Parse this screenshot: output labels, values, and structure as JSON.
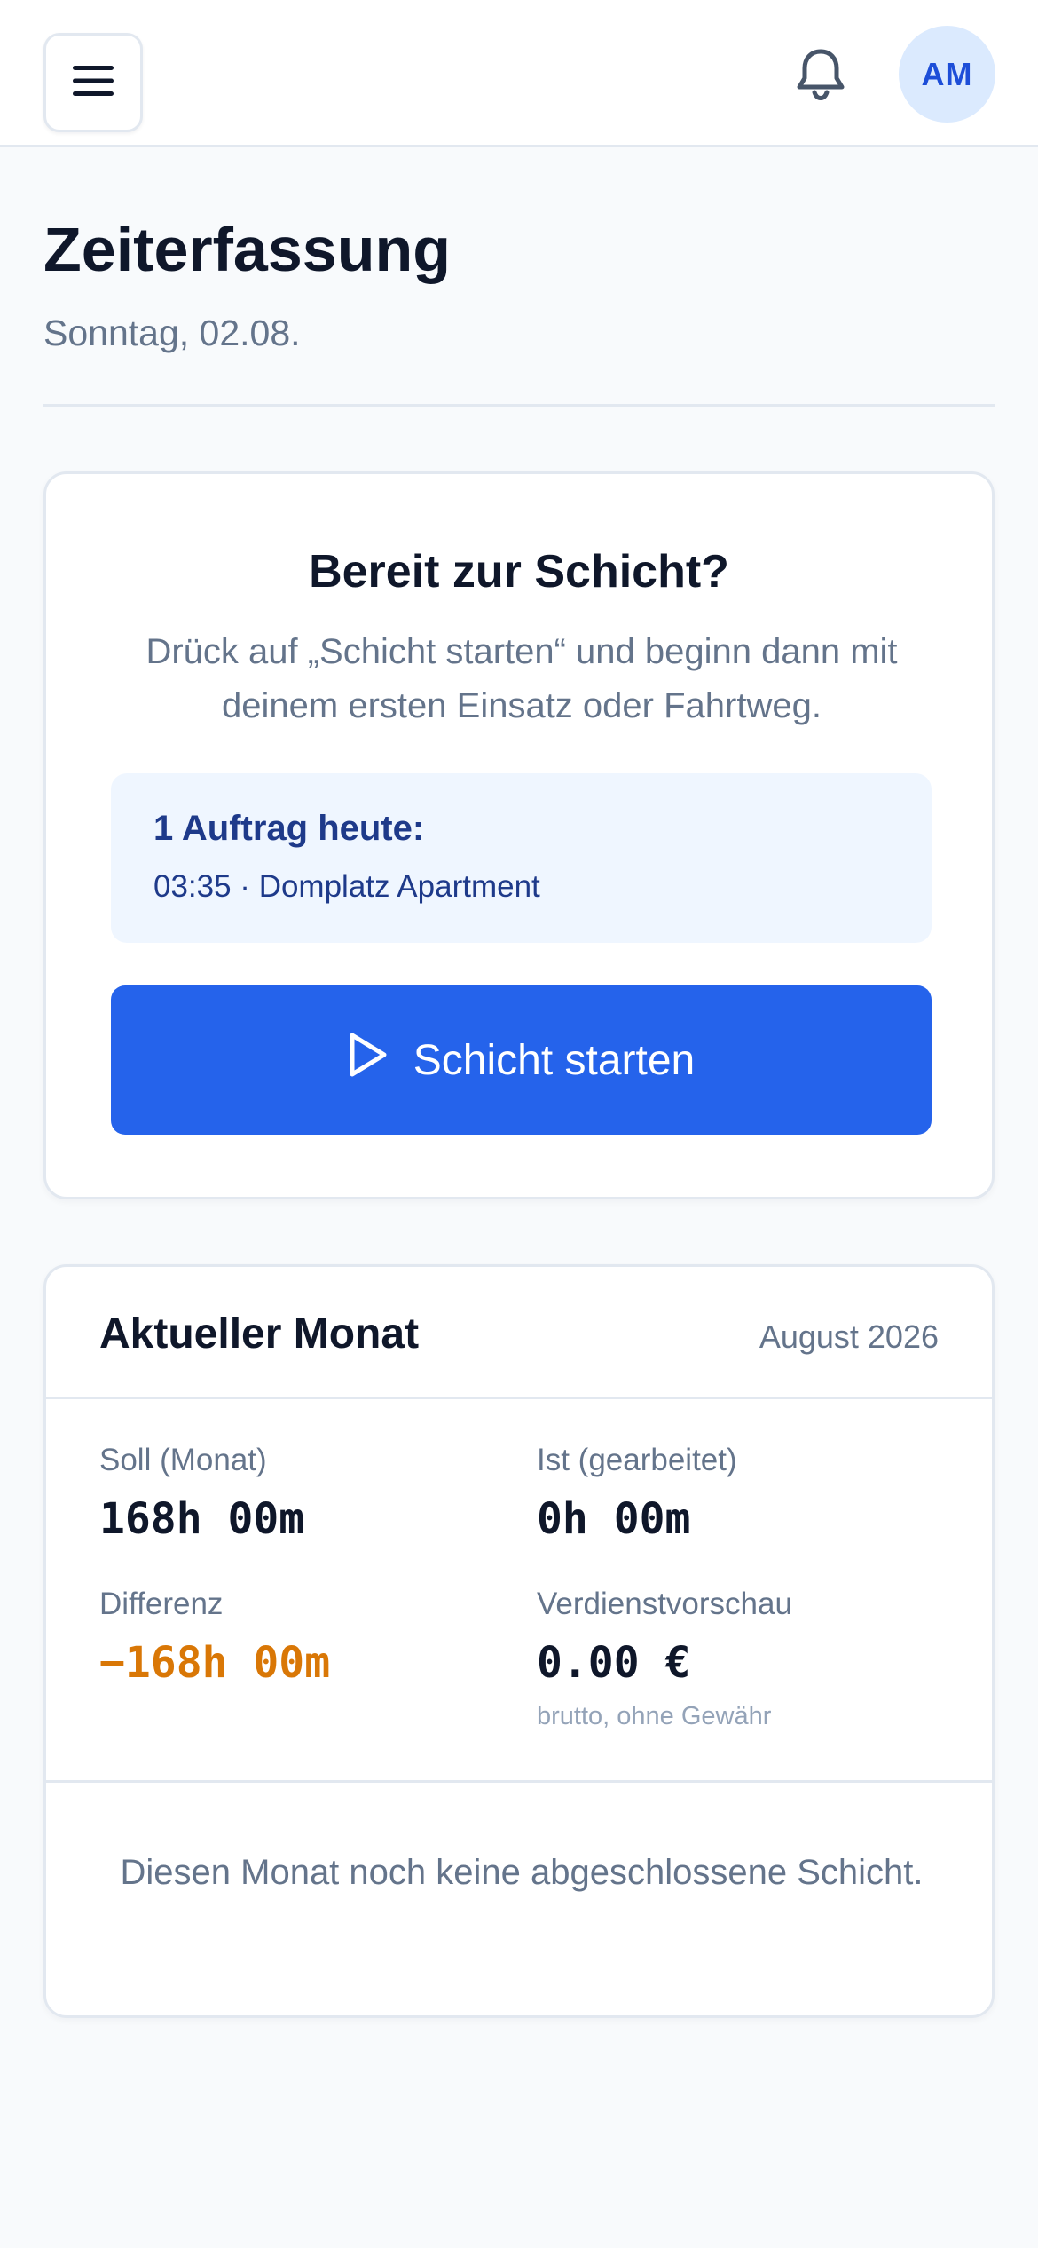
{
  "header": {
    "avatar_initials": "AM",
    "icons": {
      "menu": "menu-icon",
      "notifications": "bell-icon"
    }
  },
  "page": {
    "title": "Zeiterfassung",
    "date": "Sonntag, 02.08."
  },
  "shift": {
    "title": "Bereit zur Schicht?",
    "description": "Drück auf „Schicht starten“ und beginn dann mit deinem ersten Einsatz oder Fahrtweg.",
    "jobs_title": "1 Auftrag heute:",
    "jobs": [
      {
        "label": "03:35 · Domplatz Apartment"
      }
    ],
    "start_label": "Schicht starten",
    "start_icon": "play-icon"
  },
  "month": {
    "title": "Aktueller Monat",
    "name": "August 2026",
    "stats": {
      "target_label": "Soll (Monat)",
      "target_value": "168h 00m",
      "actual_label": "Ist (gearbeitet)",
      "actual_value": "0h 00m",
      "difference_label": "Differenz",
      "difference_value": "−168h 00m",
      "earnings_label": "Verdienstvorschau",
      "earnings_value": "0.00 €",
      "earnings_note": "brutto, ohne Gewähr"
    },
    "empty_text": "Diesen Monat noch keine abgeschlossene Schicht."
  },
  "colors": {
    "primary": "#2563eb",
    "primary_dark": "#1e3a8a",
    "info_bg": "#eff6ff",
    "negative": "#d97706",
    "text": "#0f172a",
    "muted": "#64748b",
    "border": "#e2e8f0",
    "background": "#f8fafc"
  }
}
